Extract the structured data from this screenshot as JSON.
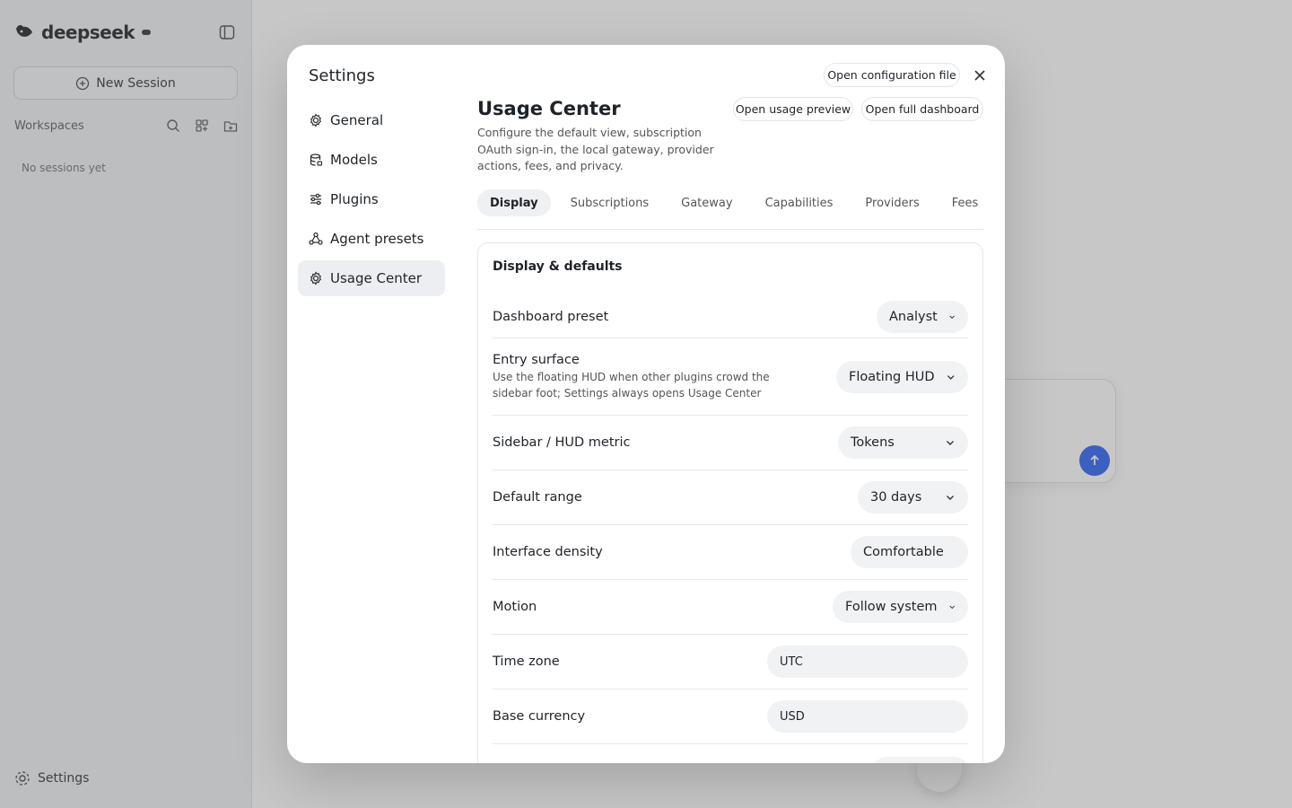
{
  "app": {
    "logo_text": "deepseek",
    "logo_badge": "",
    "new_session_label": "New Session",
    "workspaces_label": "Workspaces",
    "no_sessions": "No sessions yet",
    "settings_label": "Settings"
  },
  "modal": {
    "title": "Settings",
    "open_config_label": "Open configuration file",
    "nav": [
      {
        "label": "General",
        "icon": "gear-icon"
      },
      {
        "label": "Models",
        "icon": "database-icon"
      },
      {
        "label": "Plugins",
        "icon": "sliders-icon"
      },
      {
        "label": "Agent presets",
        "icon": "agent-icon"
      },
      {
        "label": "Usage Center",
        "icon": "gear-icon",
        "active": true
      }
    ]
  },
  "usage": {
    "title": "Usage Center",
    "description": "Configure the default view, subscription OAuth sign-in, the local gateway, provider actions, fees, and privacy.",
    "open_preview_label": "Open usage preview",
    "open_dashboard_label": "Open full dashboard",
    "tabs": [
      "Display",
      "Subscriptions",
      "Gateway",
      "Capabilities",
      "Providers",
      "Fees"
    ],
    "active_tab": "Display"
  },
  "display": {
    "section_title": "Display & defaults",
    "dashboard_preset": {
      "label": "Dashboard preset",
      "value": "Analyst"
    },
    "entry_surface": {
      "label": "Entry surface",
      "help": "Use the floating HUD when other plugins crowd the sidebar foot; Settings always opens Usage Center",
      "value": "Floating HUD"
    },
    "sidebar_metric": {
      "label": "Sidebar / HUD metric",
      "value": "Tokens"
    },
    "default_range": {
      "label": "Default range",
      "value": "30 days"
    },
    "density": {
      "label": "Interface density",
      "value": "Comfortable"
    },
    "motion": {
      "label": "Motion",
      "value": "Follow system"
    },
    "time_zone": {
      "label": "Time zone",
      "value": "UTC"
    },
    "base_currency": {
      "label": "Base currency",
      "value": "USD"
    }
  }
}
